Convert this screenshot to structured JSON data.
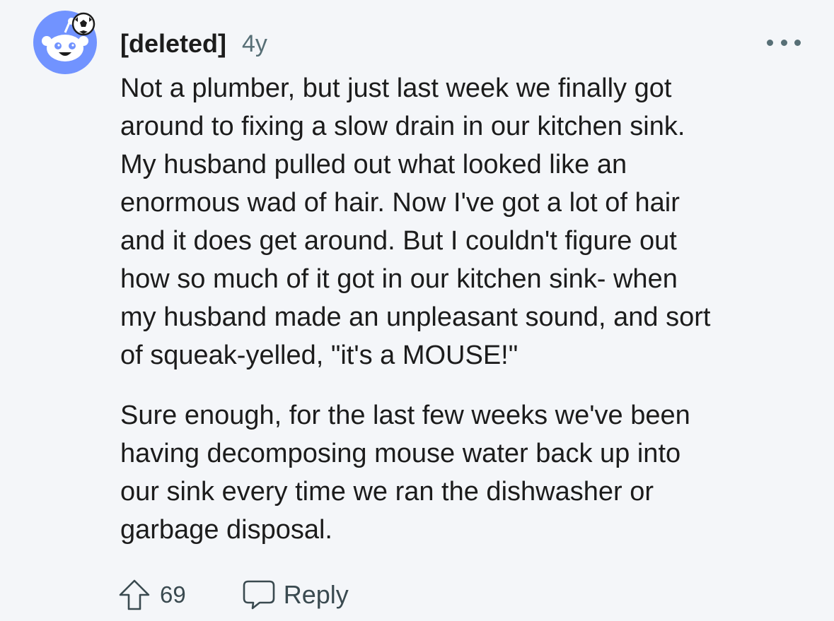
{
  "comment": {
    "author": "[deleted]",
    "age": "4y",
    "avatar_icon": "snoo-avatar-icon",
    "more_icon": "more-options-icon",
    "paragraphs": [
      {
        "lines": [
          "Not a plumber, but just last week we finally got",
          "around to fixing a slow drain in our kitchen sink.",
          "My husband pulled out what looked like an",
          "enormous wad of hair. Now I've got a lot of hair",
          "and it does get around. But I couldn't figure out",
          "how so much of it got in our kitchen sink- when",
          "my husband made an unpleasant sound, and sort",
          "of squeak-yelled, \"it's a MOUSE!\""
        ]
      },
      {
        "lines": [
          "Sure enough, for the last few weeks we've been",
          "having decomposing mouse water back up into",
          "our sink every time we ran the dishwasher or",
          "garbage disposal."
        ]
      }
    ],
    "actions": {
      "upvote_icon": "upvote-arrow-icon",
      "upvote_count": "69",
      "reply_icon": "speech-bubble-icon",
      "reply_label": "Reply"
    }
  },
  "colors": {
    "background": "#f4f6f9",
    "text": "#1c1c1c",
    "meta": "#576f76",
    "avatar_bg": "#7193ff"
  }
}
